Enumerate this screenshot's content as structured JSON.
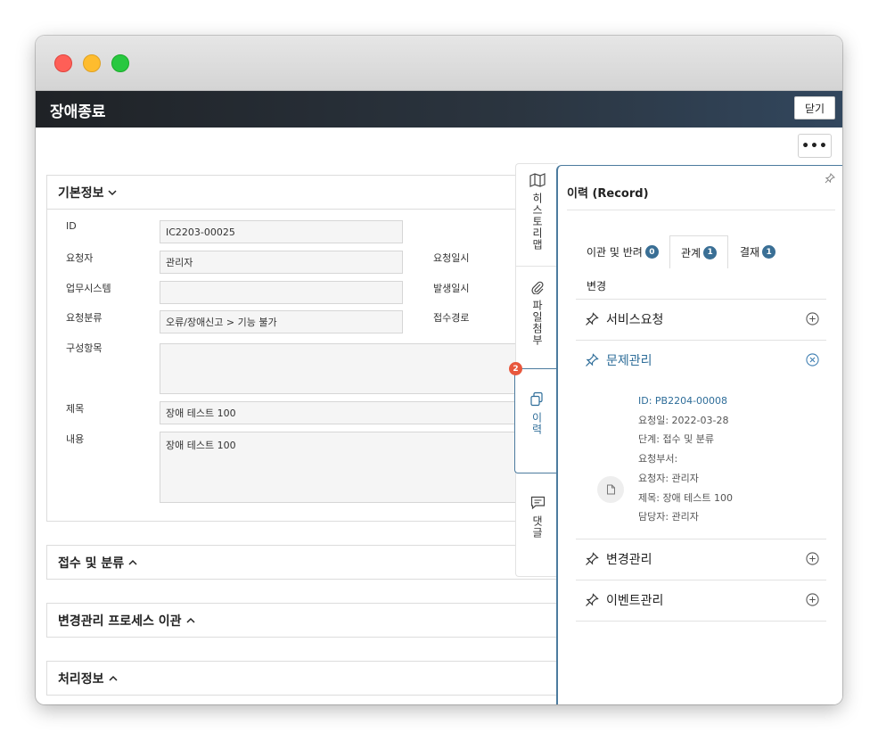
{
  "window": {
    "controls": [
      "close",
      "minimize",
      "zoom"
    ]
  },
  "header": {
    "title": "장애종료",
    "close_label": "닫기"
  },
  "more_label": "•••",
  "basic_info": {
    "heading": "기본정보",
    "fields": {
      "id_label": "ID",
      "id_value": "IC2203-00025",
      "requester_label": "요청자",
      "requester_value": "관리자",
      "request_time_label": "요청일시",
      "system_label": "업무시스템",
      "system_value": "",
      "occur_time_label": "발생일시",
      "category_label": "요청분류",
      "category_value": "오류/장애신고 > 기능 불가",
      "channel_label": "접수경로",
      "config_label": "구성항목",
      "config_value": "",
      "subject_label": "제목",
      "subject_value": "장애 테스트 100",
      "content_label": "내용",
      "content_value": "장애 테스트 100"
    }
  },
  "sections": [
    {
      "heading": "접수 및 분류"
    },
    {
      "heading": "변경관리 프로세스 이관"
    },
    {
      "heading": "처리정보"
    }
  ],
  "side_tabs": [
    {
      "label": "히스토리맵",
      "icon": "map-icon"
    },
    {
      "label": "파일첨부",
      "icon": "paperclip-icon"
    },
    {
      "label": "이력",
      "icon": "copy-icon",
      "badge": "2"
    },
    {
      "label": "댓글",
      "icon": "comment-icon"
    }
  ],
  "record_panel": {
    "title": "이력 (Record)",
    "tabs": [
      {
        "label": "이관 및 반려",
        "count": "0"
      },
      {
        "label": "관계",
        "count": "1"
      },
      {
        "label": "결재",
        "count": "1"
      }
    ],
    "sub_tab": "변경",
    "items": [
      {
        "label": "서비스요청",
        "state": "add"
      },
      {
        "label": "문제관리",
        "state": "remove"
      },
      {
        "label": "변경관리",
        "state": "add"
      },
      {
        "label": "이벤트관리",
        "state": "add"
      }
    ],
    "detail": {
      "id": "ID: PB2204-00008",
      "date": "요청일: 2022-03-28",
      "stage": "단계: 접수 및 분류",
      "dept": "요청부서:",
      "requester": "요청자: 관리자",
      "subject": "제목: 장애 테스트 100",
      "assignee": "담당자: 관리자"
    }
  },
  "colors": {
    "accent": "#3a6f95",
    "header_dark": "#1f2226",
    "badge_red": "#e8573d"
  }
}
